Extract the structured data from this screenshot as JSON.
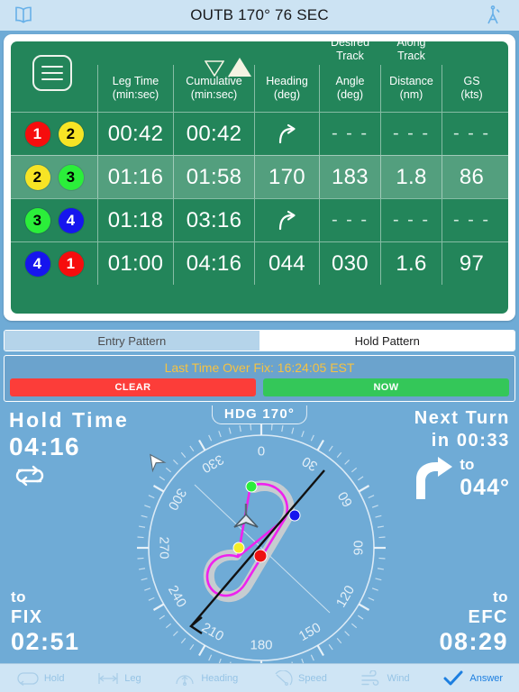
{
  "navbar": {
    "title": "OUTB 170°  76 SEC",
    "left_icon": "book-icon",
    "right_icon": "dividers-icon"
  },
  "table": {
    "menu_icon": "hamburger-menu-icon",
    "sort_down_icon": "triangle-down-icon",
    "sort_up_icon": "triangle-up-icon",
    "columns": [
      {
        "id": "badges",
        "top": "",
        "mid": "",
        "line1": "",
        "line2": ""
      },
      {
        "id": "leg",
        "top": "",
        "mid": "",
        "line1": "Leg Time",
        "line2": "(min:sec)"
      },
      {
        "id": "cum",
        "top": "",
        "mid": "",
        "line1": "Cumulative",
        "line2": "(min:sec)"
      },
      {
        "id": "hdg",
        "top": "",
        "mid": "",
        "line1": "Heading",
        "line2": "(deg)"
      },
      {
        "id": "dta",
        "top": "Desired",
        "mid": "Track",
        "line1": "Angle",
        "line2": "(deg)"
      },
      {
        "id": "atd",
        "top": "Along",
        "mid": "Track",
        "line1": "Distance",
        "line2": "(nm)"
      },
      {
        "id": "gs",
        "top": "",
        "mid": "",
        "line1": "GS",
        "line2": "(kts)"
      }
    ],
    "rows": [
      {
        "badge_a": "1",
        "badge_a_color": "#f60d0d",
        "badge_a_dark": false,
        "badge_b": "2",
        "badge_b_color": "#f7e425",
        "badge_b_dark": true,
        "leg": "00:42",
        "cum": "00:42",
        "hdg": "turn-right-icon",
        "dta": "- - -",
        "atd": "- - -",
        "gs": "- - -",
        "selected": false
      },
      {
        "badge_a": "2",
        "badge_a_color": "#f7e425",
        "badge_a_dark": true,
        "badge_b": "3",
        "badge_b_color": "#2bee3a",
        "badge_b_dark": true,
        "leg": "01:16",
        "cum": "01:58",
        "hdg": "170",
        "dta": "183",
        "atd": "1.8",
        "gs": "86",
        "selected": true
      },
      {
        "badge_a": "3",
        "badge_a_color": "#2bee3a",
        "badge_a_dark": true,
        "badge_b": "4",
        "badge_b_color": "#1615ee",
        "badge_b_dark": false,
        "leg": "01:18",
        "cum": "03:16",
        "hdg": "turn-right-icon",
        "dta": "- - -",
        "atd": "- - -",
        "gs": "- - -",
        "selected": false
      },
      {
        "badge_a": "4",
        "badge_a_color": "#1615ee",
        "badge_a_dark": false,
        "badge_b": "1",
        "badge_b_color": "#f60d0d",
        "badge_b_dark": false,
        "leg": "01:00",
        "cum": "04:16",
        "hdg": "044",
        "dta": "030",
        "atd": "1.6",
        "gs": "97",
        "selected": false
      }
    ]
  },
  "tabs": [
    {
      "label": "Entry Pattern",
      "active": false
    },
    {
      "label": "Hold Pattern",
      "active": true
    }
  ],
  "fix_panel": {
    "label": "Last Time Over Fix:  16:24:05 EST",
    "clear_label": "CLEAR",
    "now_label": "NOW"
  },
  "hold_time": {
    "label": "Hold Time",
    "value": "04:16",
    "loop_icon": "repeat-loop-icon"
  },
  "next_turn": {
    "line1": "Next Turn",
    "line2": "in 00:33",
    "arrow_icon": "turn-right-big-icon",
    "to_label": "to",
    "to_value": "044°"
  },
  "to_fix": {
    "t1": "to",
    "t2": "FIX",
    "t3": "02:51"
  },
  "to_efc": {
    "t1": "to",
    "t2": "EFC",
    "t3": "08:29"
  },
  "hdg_pill": {
    "label": "HDG 170°"
  },
  "compass": {
    "labels": [
      "0",
      "30",
      "60",
      "90",
      "120",
      "150",
      "180",
      "210",
      "240",
      "270",
      "300",
      "330"
    ],
    "aircraft_icon": "aircraft-symbol",
    "outer_aircraft_icon": "wind-aircraft-icon",
    "points": [
      {
        "name": "fix-point",
        "color": "#ee1111"
      },
      {
        "name": "outbound-abeam-point",
        "color": "#f5ec2a"
      },
      {
        "name": "outbound-end-point",
        "color": "#2bee3a"
      },
      {
        "name": "inbound-turn-point",
        "color": "#1615ee"
      }
    ],
    "track_color": "#ee22ee",
    "shadow_color": "#cfcfcf",
    "course_line_color": "#111111"
  },
  "toolbar": [
    {
      "label": "Hold",
      "icon": "hold-pattern-icon",
      "active": false
    },
    {
      "label": "Leg",
      "icon": "leg-length-icon",
      "active": false
    },
    {
      "label": "Heading",
      "icon": "heading-dial-icon",
      "active": false
    },
    {
      "label": "Speed",
      "icon": "airspeed-icon",
      "active": false
    },
    {
      "label": "Wind",
      "icon": "wind-icon",
      "active": false
    },
    {
      "label": "Answer",
      "icon": "checkmark-icon",
      "active": true
    }
  ],
  "colors": {
    "background": "#6fabd6",
    "table_green": "#23855a",
    "navbar": "#cce3f3",
    "accent_yellow": "#f5c242",
    "clear_red": "#fc3d39",
    "now_green": "#34c759",
    "toolbar_blue": "#1d7fe0"
  }
}
